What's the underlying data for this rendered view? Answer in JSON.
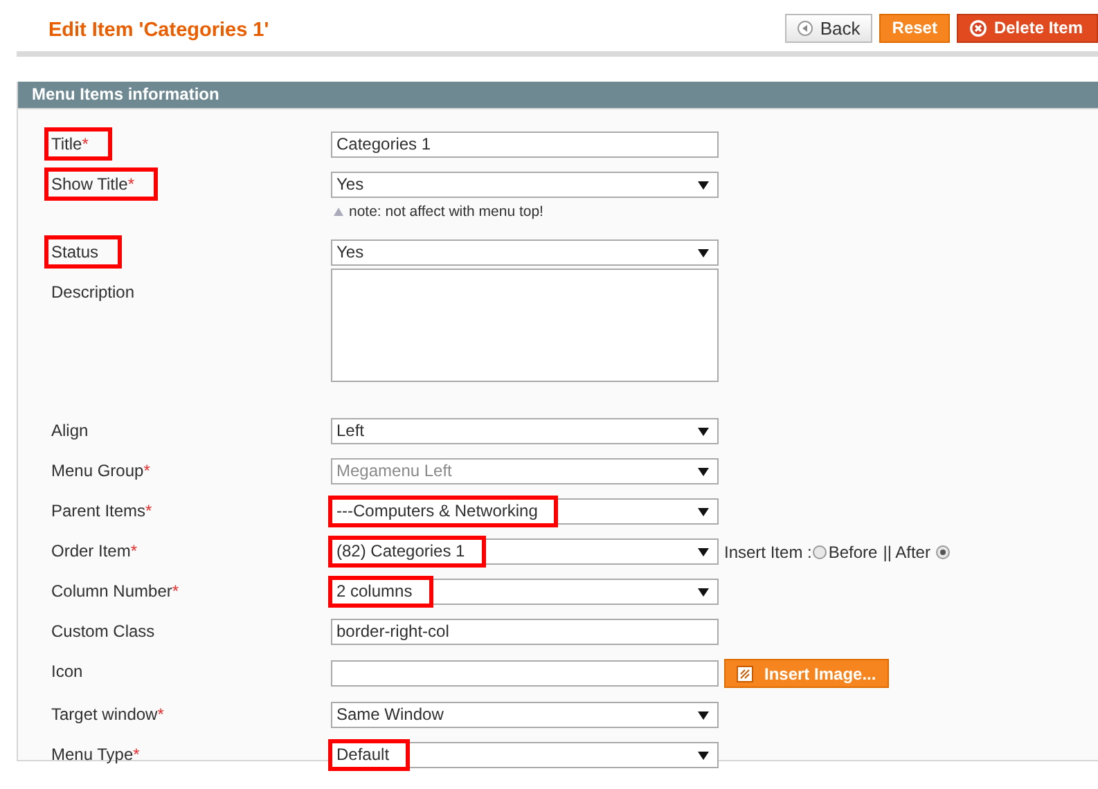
{
  "page_title": "Edit Item 'Categories 1'",
  "header_buttons": [
    {
      "label": "Back",
      "kind": "back"
    },
    {
      "label": "Reset",
      "kind": "reset"
    },
    {
      "label": "Delete Item",
      "kind": "delete"
    }
  ],
  "section": {
    "title": "Menu Items information"
  },
  "fields": [
    {
      "label": "Title",
      "required_mark": "*",
      "kind": "text",
      "value": "Categories 1",
      "label_highlighted": true,
      "value_highlighted": false
    },
    {
      "label": "Show Title",
      "required_mark": "*",
      "kind": "select",
      "value": "Yes",
      "label_highlighted": true,
      "value_highlighted": false,
      "note": "note: not affect with menu top!"
    },
    {
      "label": "Status",
      "kind": "select",
      "value": "Yes",
      "label_highlighted": true,
      "value_highlighted": false
    },
    {
      "label": "Description",
      "kind": "textarea",
      "label_highlighted": false,
      "value_highlighted": false
    },
    {
      "label": "Align",
      "kind": "select",
      "value": "Left",
      "label_highlighted": false,
      "value_highlighted": false
    },
    {
      "label": "Menu Group",
      "required_mark": "*",
      "kind": "select",
      "value": "Megamenu Left",
      "disabled": true,
      "label_highlighted": false,
      "value_highlighted": false
    },
    {
      "label": "Parent Items",
      "required_mark": "*",
      "kind": "select",
      "value": "---Computers & Networking",
      "label_highlighted": false,
      "value_highlighted": true
    },
    {
      "label": "Order Item",
      "required_mark": "*",
      "kind": "select",
      "value": "(82) Categories 1",
      "label_highlighted": false,
      "value_highlighted": true,
      "insert": {
        "label": "Insert Item : ",
        "options": [
          {
            "label": "Before",
            "selected": false
          },
          {
            "label": "|| After",
            "selected": true
          }
        ]
      }
    },
    {
      "label": "Column Number",
      "required_mark": "*",
      "kind": "select",
      "value": "2 columns",
      "label_highlighted": false,
      "value_highlighted": true
    },
    {
      "label": "Custom Class",
      "kind": "text",
      "value": "border-right-col",
      "label_highlighted": false,
      "value_highlighted": false
    },
    {
      "label": "Icon",
      "kind": "image",
      "button": "Insert Image...",
      "label_highlighted": false,
      "value_highlighted": false
    },
    {
      "label": "Target window",
      "required_mark": "*",
      "kind": "select",
      "value": "Same Window",
      "label_highlighted": false,
      "value_highlighted": false
    },
    {
      "label": "Menu Type",
      "required_mark": "*",
      "kind": "select",
      "value": "Default",
      "label_highlighted": false,
      "value_highlighted": true
    }
  ]
}
